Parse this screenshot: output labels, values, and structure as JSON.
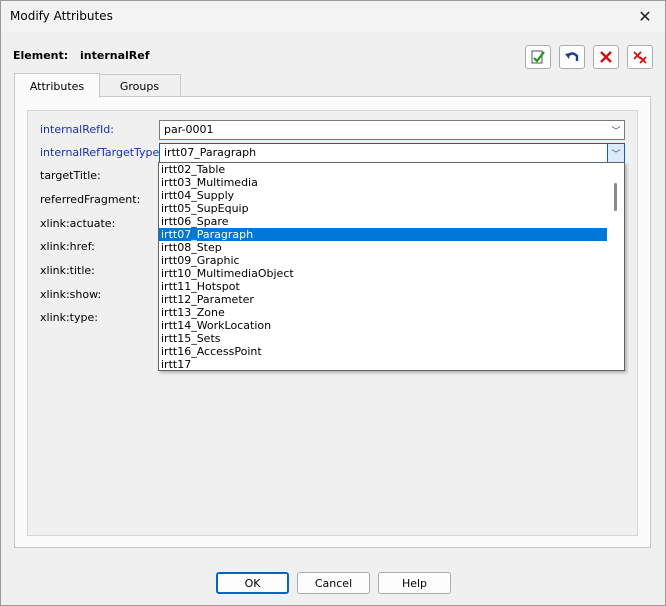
{
  "window": {
    "title": "Modify Attributes"
  },
  "element": {
    "label": "Element:",
    "name": "internalRef"
  },
  "tabs": [
    {
      "label": "Attributes"
    },
    {
      "label": "Groups"
    }
  ],
  "fields": {
    "internalRefId": {
      "label": "internalRefId:",
      "value": "par-0001"
    },
    "internalRefTargetType": {
      "label": "internalRefTargetType:",
      "value": "irtt07_Paragraph"
    },
    "targetTitle": {
      "label": "targetTitle:"
    },
    "referredFragment": {
      "label": "referredFragment:"
    },
    "xlink_actuate": {
      "label": "xlink:actuate:"
    },
    "xlink_href": {
      "label": "xlink:href:"
    },
    "xlink_title": {
      "label": "xlink:title:"
    },
    "xlink_show": {
      "label": "xlink:show:"
    },
    "xlink_type": {
      "label": "xlink:type:"
    }
  },
  "dropdown": {
    "options": [
      "irtt02_Table",
      "irtt03_Multimedia",
      "irtt04_Supply",
      "irtt05_SupEquip",
      "irtt06_Spare",
      "irtt07_Paragraph",
      "irtt08_Step",
      "irtt09_Graphic",
      "irtt10_MultimediaObject",
      "irtt11_Hotspot",
      "irtt12_Parameter",
      "irtt13_Zone",
      "irtt14_WorkLocation",
      "irtt15_Sets",
      "irtt16_AccessPoint",
      "irtt17"
    ],
    "selected": "irtt07_Paragraph"
  },
  "buttons": {
    "ok": "OK",
    "cancel": "Cancel",
    "help": "Help"
  },
  "toolbar_icons": [
    "apply-check-icon",
    "undo-icon",
    "delete-red-x-icon",
    "delete-all-icon"
  ],
  "colors": {
    "selection": "#0078d7",
    "required_label": "#1a2fb0"
  }
}
